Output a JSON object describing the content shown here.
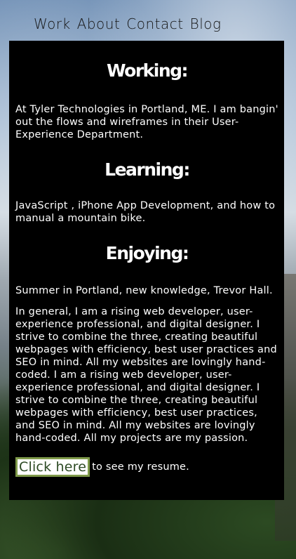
{
  "nav": {
    "items": [
      "Work",
      "About",
      "Contact",
      "Blog"
    ]
  },
  "sections": {
    "working": {
      "title": "Working:",
      "text": "At Tyler Technologies in Portland, ME. I am bangin' out the flows and wireframes in their User-Experience Department."
    },
    "learning": {
      "title": "Learning:",
      "text": "JavaScript , iPhone App Development, and how to manual a mountain bike."
    },
    "enjoying": {
      "title": "Enjoying:",
      "text": "Summer in Portland, new knowledge, Trevor Hall."
    }
  },
  "general": "In general, I am a rising web developer, user-experience professional, and digital designer. I strive to combine the three, creating beautiful webpages with efficiency, best user practices and SEO in mind. All my websites are lovingly hand-coded. I am a rising web developer, user-experience professional, and digital designer. I strive to combine the three, creating beautiful webpages with efficiency, best user practices, and SEO in mind. All my websites are lovingly hand-coded. All my projects are my passion.",
  "resume": {
    "button_label": "Click here",
    "suffix": "to see my resume."
  },
  "colors": {
    "panel": "#000000",
    "button_border": "#7f9a4a",
    "button_text": "#2d4a24"
  }
}
